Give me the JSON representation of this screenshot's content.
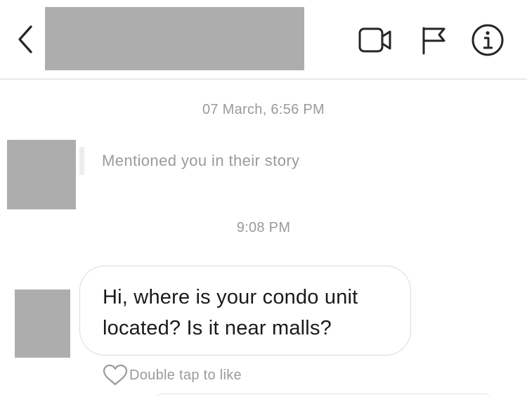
{
  "header": {
    "back_icon": "chevron-left-icon",
    "icons": [
      "video-camera-icon",
      "flag-icon",
      "info-icon"
    ]
  },
  "conversation": {
    "timestamp_1": "07 March, 6:56 PM",
    "story_mention": "Mentioned you in their story",
    "timestamp_2": "9:08 PM",
    "message": {
      "line_1": "Hi, where is your condo unit",
      "line_2": "located? Is it near malls?"
    },
    "like_hint": "Double tap to like"
  }
}
